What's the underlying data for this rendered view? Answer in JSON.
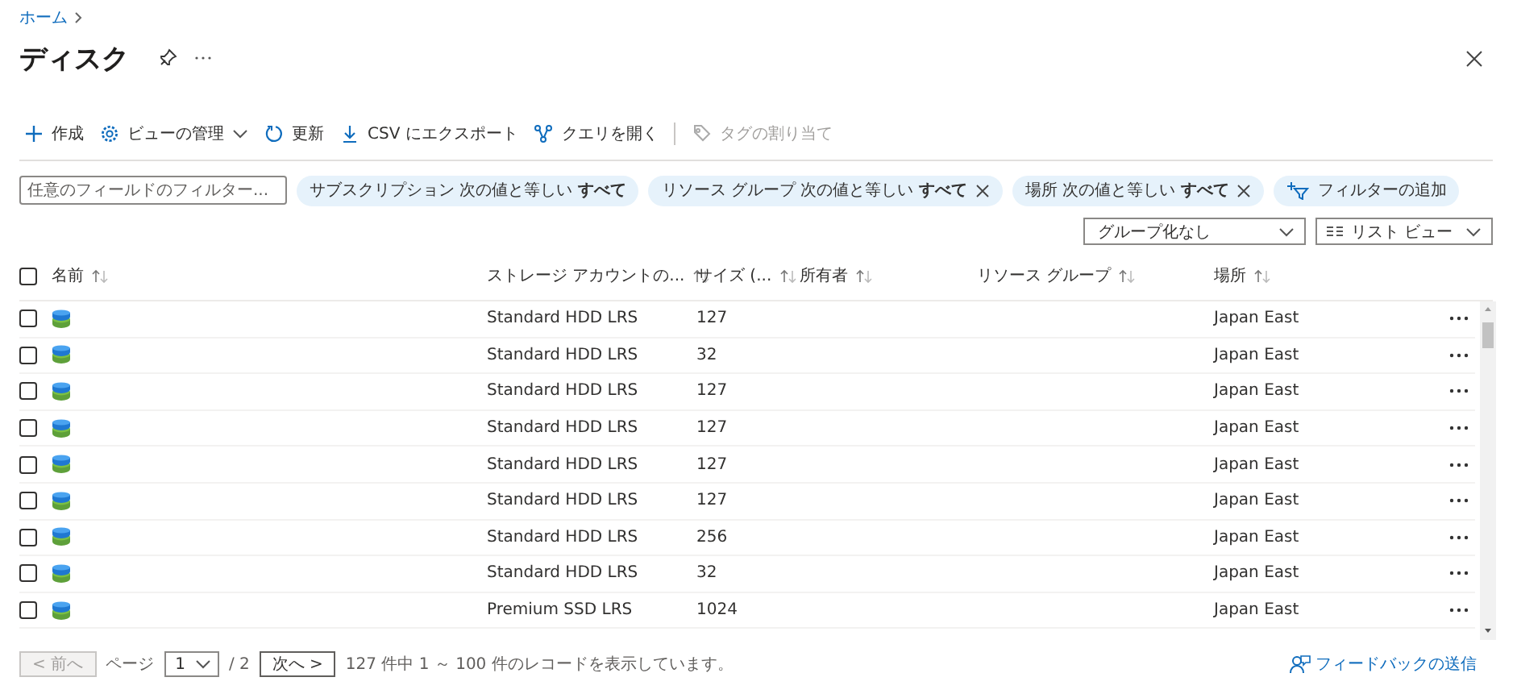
{
  "breadcrumb": [
    {
      "label": "ホーム"
    }
  ],
  "title": "ディスク",
  "toolbar": [
    {
      "kind": "plus",
      "label": "作成",
      "disabled": false,
      "dropdown": false
    },
    {
      "kind": "gear",
      "label": "ビューの管理",
      "disabled": false,
      "dropdown": true
    },
    {
      "kind": "refresh",
      "label": "更新",
      "disabled": false,
      "dropdown": false
    },
    {
      "kind": "download",
      "label": "CSV にエクスポート",
      "disabled": false,
      "dropdown": false
    },
    {
      "kind": "query",
      "label": "クエリを開く",
      "disabled": false,
      "dropdown": false
    },
    {
      "kind": "tag",
      "label": "タグの割り当て",
      "disabled": true,
      "dropdown": false
    }
  ],
  "filter_field": {
    "placeholder": "任意のフィールドのフィルター..."
  },
  "filters": [
    {
      "label": "サブスクリプション 次の値と等しい **すべて**",
      "removable": false
    },
    {
      "label": "リソース グループ 次の値と等しい **すべて**",
      "removable": true
    },
    {
      "label": "場所 次の値と等しい **すべて**",
      "removable": true
    }
  ],
  "add_filter": "フィルターの追加",
  "grouping": {
    "value": "グループ化なし"
  },
  "view": {
    "value": "リスト ビュー"
  },
  "table": {
    "select_all_checked": false,
    "columns": [
      {
        "label": "名前"
      },
      {
        "label": "ストレージ アカウントの..."
      },
      {
        "label": "サイズ (..."
      },
      {
        "label": "所有者"
      },
      {
        "label": "リソース グループ"
      },
      {
        "label": "場所"
      }
    ],
    "rows": [
      {
        "checked": false,
        "storage": "Standard HDD LRS",
        "size": "127",
        "location": "Japan East"
      },
      {
        "checked": false,
        "storage": "Standard HDD LRS",
        "size": "32",
        "location": "Japan East"
      },
      {
        "checked": false,
        "storage": "Standard HDD LRS",
        "size": "127",
        "location": "Japan East"
      },
      {
        "checked": false,
        "storage": "Standard HDD LRS",
        "size": "127",
        "location": "Japan East"
      },
      {
        "checked": false,
        "storage": "Standard HDD LRS",
        "size": "127",
        "location": "Japan East"
      },
      {
        "checked": false,
        "storage": "Standard HDD LRS",
        "size": "127",
        "location": "Japan East"
      },
      {
        "checked": false,
        "storage": "Standard HDD LRS",
        "size": "256",
        "location": "Japan East"
      },
      {
        "checked": false,
        "storage": "Standard HDD LRS",
        "size": "32",
        "location": "Japan East"
      },
      {
        "checked": false,
        "storage": "Premium SSD LRS",
        "size": "1024",
        "location": "Japan East"
      }
    ]
  },
  "pagination": {
    "prev": {
      "label": "< 前へ",
      "disabled": true
    },
    "page_label": "ページ",
    "page": "1",
    "total": "/ 2",
    "next": {
      "label": "次へ >",
      "disabled": false
    },
    "status": "127 件中 1 ～ 100 件のレコードを表示しています。"
  },
  "feedback": "フィードバックの送信"
}
